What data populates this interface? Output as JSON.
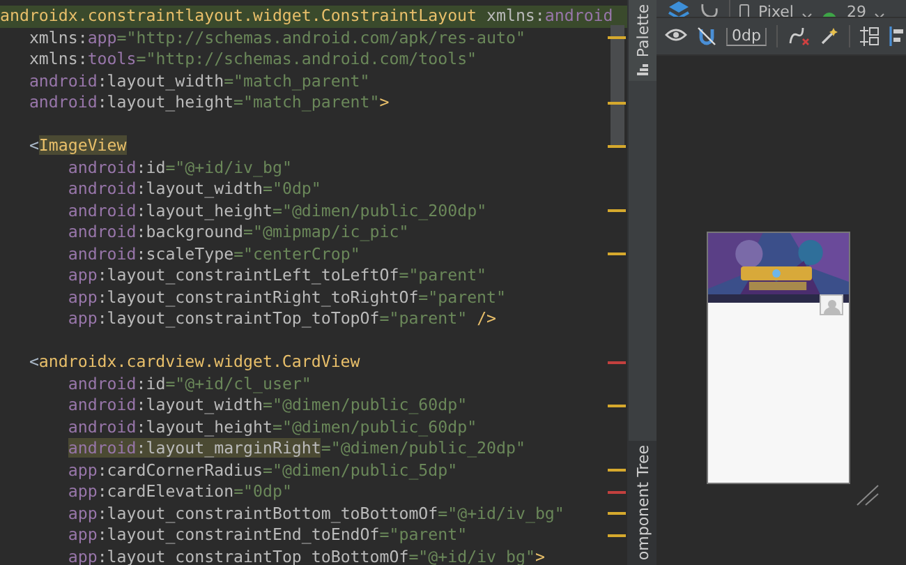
{
  "editor": {
    "lines": [
      {
        "kind": "tag",
        "highlighted": true,
        "tokens": [
          {
            "kind": "tag",
            "text": "androidx.constraintlayout.widget.ConstraintLayout"
          },
          {
            "kind": "attr",
            "text": " xmlns:"
          },
          {
            "kind": "ns",
            "text": "android"
          }
        ]
      },
      {
        "kind": "attribute",
        "color": "#d6a92d",
        "tokens": [
          {
            "kind": "attr",
            "text": "xmlns:"
          },
          {
            "kind": "ns",
            "text": "app"
          },
          {
            "kind": "value",
            "text": "=\"http://schemas.android.com/apk/res-auto\""
          }
        ]
      },
      {
        "kind": "attribute",
        "tokens": [
          {
            "kind": "attr",
            "text": "xmlns:"
          },
          {
            "kind": "ns",
            "text": "tools"
          },
          {
            "kind": "value",
            "text": "=\"http://schemas.android.com/tools\""
          }
        ]
      },
      {
        "kind": "attribute",
        "tokens": [
          {
            "kind": "ns",
            "text": "android"
          },
          {
            "kind": "attr",
            "text": ":layout_width"
          },
          {
            "kind": "value",
            "text": "=\"match_parent\""
          }
        ]
      },
      {
        "kind": "attribute",
        "color": "#d6a92d",
        "tokens": [
          {
            "kind": "ns",
            "text": "android"
          },
          {
            "kind": "attr",
            "text": ":layout_height"
          },
          {
            "kind": "value",
            "text": "=\"match_parent\""
          },
          {
            "kind": "tag",
            "text": ">"
          }
        ]
      },
      {
        "kind": "blank"
      },
      {
        "kind": "child_tag",
        "color": "#d6a92d",
        "tokens": [
          {
            "kind": "punct",
            "text": "<"
          },
          {
            "kind": "tag",
            "text": "ImageView",
            "highlight": true
          }
        ]
      },
      {
        "kind": "child_attribute",
        "tokens": [
          {
            "kind": "ns",
            "text": "android"
          },
          {
            "kind": "attr",
            "text": ":id"
          },
          {
            "kind": "value",
            "text": "=\"@+id/iv_bg\""
          }
        ]
      },
      {
        "kind": "child_attribute",
        "tokens": [
          {
            "kind": "ns",
            "text": "android"
          },
          {
            "kind": "attr",
            "text": ":layout_width"
          },
          {
            "kind": "value",
            "text": "=\"0dp\""
          }
        ]
      },
      {
        "kind": "child_attribute",
        "color": "#d6a92d",
        "tokens": [
          {
            "kind": "ns",
            "text": "android"
          },
          {
            "kind": "attr",
            "text": ":layout_height"
          },
          {
            "kind": "value",
            "text": "=\"@dimen/public_200dp\""
          }
        ]
      },
      {
        "kind": "child_attribute",
        "tokens": [
          {
            "kind": "ns",
            "text": "android"
          },
          {
            "kind": "attr",
            "text": ":background"
          },
          {
            "kind": "value",
            "text": "=\"@mipmap/ic_pic\""
          }
        ]
      },
      {
        "kind": "child_attribute",
        "color": "#d6a92d",
        "tokens": [
          {
            "kind": "ns",
            "text": "android"
          },
          {
            "kind": "attr",
            "text": ":scaleType"
          },
          {
            "kind": "value",
            "text": "=\"centerCrop\""
          }
        ]
      },
      {
        "kind": "child_attribute",
        "tokens": [
          {
            "kind": "ns",
            "text": "app"
          },
          {
            "kind": "attr",
            "text": ":layout_constraintLeft_toLeftOf"
          },
          {
            "kind": "value",
            "text": "=\"parent\""
          }
        ]
      },
      {
        "kind": "child_attribute",
        "tokens": [
          {
            "kind": "ns",
            "text": "app"
          },
          {
            "kind": "attr",
            "text": ":layout_constraintRight_toRightOf"
          },
          {
            "kind": "value",
            "text": "=\"parent\""
          }
        ]
      },
      {
        "kind": "child_attribute",
        "tokens": [
          {
            "kind": "ns",
            "text": "app"
          },
          {
            "kind": "attr",
            "text": ":layout_constraintTop_toTopOf"
          },
          {
            "kind": "value",
            "text": "=\"parent\" "
          },
          {
            "kind": "tag",
            "text": "/>"
          }
        ]
      },
      {
        "kind": "blank"
      },
      {
        "kind": "child_tag",
        "color": "#c3403e",
        "tokens": [
          {
            "kind": "punct",
            "text": "<"
          },
          {
            "kind": "tag",
            "text": "androidx.cardview.widget.CardView"
          }
        ]
      },
      {
        "kind": "child_attribute",
        "tokens": [
          {
            "kind": "ns",
            "text": "android"
          },
          {
            "kind": "attr",
            "text": ":id"
          },
          {
            "kind": "value",
            "text": "=\"@+id/cl_user\""
          }
        ]
      },
      {
        "kind": "child_attribute",
        "color": "#d6a92d",
        "tokens": [
          {
            "kind": "ns",
            "text": "android"
          },
          {
            "kind": "attr",
            "text": ":layout_width"
          },
          {
            "kind": "value",
            "text": "=\"@dimen/public_60dp\""
          }
        ]
      },
      {
        "kind": "child_attribute",
        "tokens": [
          {
            "kind": "ns",
            "text": "android"
          },
          {
            "kind": "attr",
            "text": ":layout_height"
          },
          {
            "kind": "value",
            "text": "=\"@dimen/public_60dp\""
          }
        ]
      },
      {
        "kind": "child_attribute",
        "tokens": [
          {
            "kind": "ns",
            "text": "android",
            "highlight": true
          },
          {
            "kind": "attr",
            "text": ":layout_marginRight",
            "highlight": true
          },
          {
            "kind": "value",
            "text": "=\"@dimen/public_20dp\""
          }
        ]
      },
      {
        "kind": "child_attribute",
        "color": "#d6a92d",
        "tokens": [
          {
            "kind": "ns",
            "text": "app"
          },
          {
            "kind": "attr",
            "text": ":cardCornerRadius"
          },
          {
            "kind": "value",
            "text": "=\"@dimen/public_5dp\""
          }
        ]
      },
      {
        "kind": "child_attribute",
        "color": "#c3403e",
        "tokens": [
          {
            "kind": "ns",
            "text": "app"
          },
          {
            "kind": "attr",
            "text": ":cardElevation"
          },
          {
            "kind": "value",
            "text": "=\"0dp\""
          }
        ]
      },
      {
        "kind": "child_attribute",
        "color": "#d6a92d",
        "tokens": [
          {
            "kind": "ns",
            "text": "app"
          },
          {
            "kind": "attr",
            "text": ":layout_constraintBottom_toBottomOf"
          },
          {
            "kind": "value",
            "text": "=\"@+id/iv_bg\""
          }
        ]
      },
      {
        "kind": "child_attribute",
        "color": "#d6a92d",
        "tokens": [
          {
            "kind": "ns",
            "text": "app"
          },
          {
            "kind": "attr",
            "text": ":layout_constraintEnd_toEndOf"
          },
          {
            "kind": "value",
            "text": "=\"parent\""
          }
        ]
      },
      {
        "kind": "child_attribute",
        "tokens": [
          {
            "kind": "ns",
            "text": "app"
          },
          {
            "kind": "attr",
            "text": ":layout_constraintTop_toBottomOf"
          },
          {
            "kind": "value",
            "text": "=\"@+id/iv_bg\""
          },
          {
            "kind": "tag",
            "text": ">"
          }
        ]
      }
    ]
  },
  "side_tabs": [
    {
      "label": "Palette",
      "selected": true
    },
    {
      "label": "omponent Tree",
      "selected": false
    }
  ],
  "toolbar": {
    "device": "Pixel",
    "api": "29",
    "margin": "0dp"
  }
}
